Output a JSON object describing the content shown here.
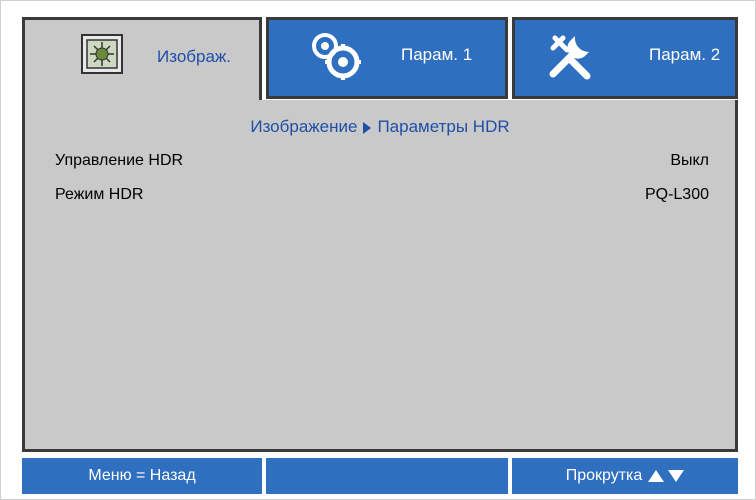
{
  "tabs": [
    {
      "label": "Изображ.",
      "icon": "picture-settings-icon",
      "active": true
    },
    {
      "label": "Парам. 1",
      "icon": "gears-icon",
      "active": false
    },
    {
      "label": "Парам. 2",
      "icon": "tools-icon",
      "active": false
    }
  ],
  "breadcrumb": {
    "parent": "Изображение",
    "current": "Параметры HDR"
  },
  "rows": [
    {
      "label": "Управление HDR",
      "value": "Выкл"
    },
    {
      "label": "Режим HDR",
      "value": "PQ-L300"
    }
  ],
  "footer": {
    "back": "Меню = Назад",
    "middle": "",
    "scroll": "Прокрутка"
  },
  "colors": {
    "accent": "#2f6fc0",
    "panel": "#c9c9c9",
    "text_blue": "#1f4fa8"
  }
}
